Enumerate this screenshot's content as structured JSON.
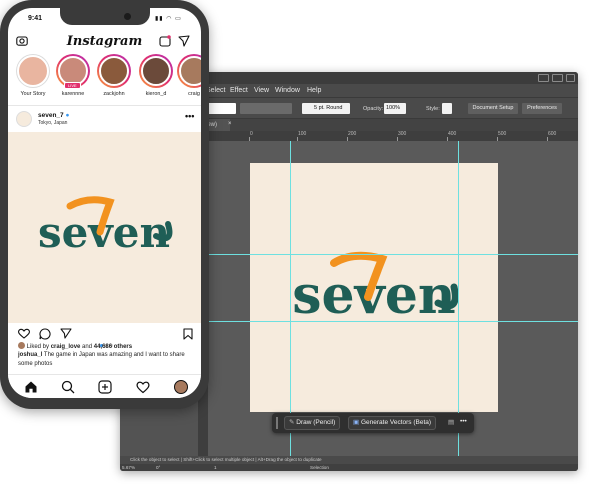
{
  "colors": {
    "artboard": "#f6ebdd",
    "logo_teal": "#1f5e56",
    "logo_orange": "#f2921f",
    "guide": "#6ee0e0",
    "ig_verified": "#3897f0"
  },
  "logo_text": "seven",
  "illustrator": {
    "menus": [
      "Select",
      "Effect",
      "View",
      "Window",
      "Help"
    ],
    "control": {
      "brush": "5 pt. Round",
      "opacity_label": "Opacity:",
      "opacity_value": "100%",
      "style_label": "Style:",
      "document_setup": "Document Setup",
      "preferences": "Preferences"
    },
    "doc_tab": "iew)",
    "doc_tab_close": "×",
    "ruler_numbers": [
      "0",
      "100",
      "200",
      "300",
      "400",
      "500",
      "600"
    ],
    "context_bar": {
      "draw": "Draw (Pencil)",
      "generate": "Generate Vectors (Beta)",
      "more": "•••"
    },
    "status_hint": "Click the object to select  |  Shift+Click to select multiple object  |  Alt+Drag the object to duplicate",
    "zoom": "5.67%",
    "rotation": "0°",
    "artboard_number": "1",
    "selection_label": "Selection"
  },
  "instagram": {
    "time": "9:41",
    "logo": "Instagram",
    "stories": [
      {
        "name": "Your Story",
        "color": "#e9b5a0"
      },
      {
        "name": "karennne",
        "color": "#c98a7a",
        "live": "LIVE"
      },
      {
        "name": "zackjohn",
        "color": "#8a5a3c"
      },
      {
        "name": "kieron_d",
        "color": "#6b4a3a"
      },
      {
        "name": "craig",
        "color": "#a77a5e"
      }
    ],
    "post": {
      "username": "seven_7",
      "location": "Tokyo, Japan",
      "more": "•••",
      "likes_prefix": "Liked by ",
      "likes_user": "craig_love",
      "likes_mid": " and ",
      "likes_count": "44,686 others",
      "caption_user": "joshua_l",
      "caption_text": " The game in Japan was amazing and I want to share some photos"
    }
  }
}
